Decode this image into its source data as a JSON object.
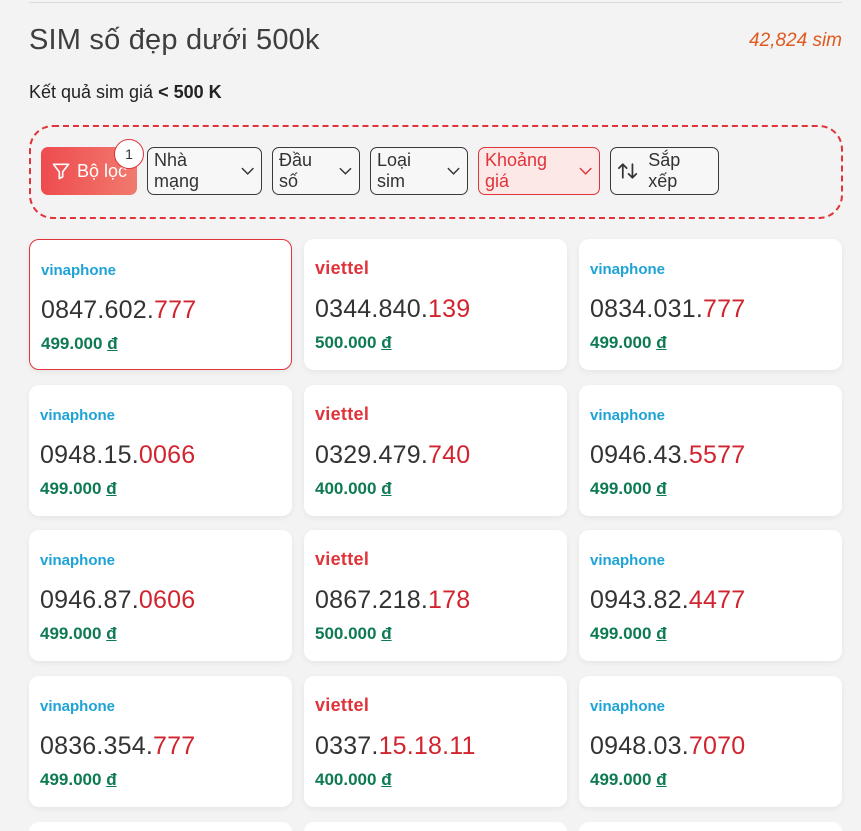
{
  "header": {
    "title": "SIM số đẹp dưới 500k",
    "count": "42,824 sim",
    "subtitle_prefix": "Kết quả sim giá",
    "subtitle_value": "< 500 K"
  },
  "filters": {
    "filter_label": "Bộ lọc",
    "filter_badge": "1",
    "network_label": "Nhà mạng",
    "prefix_label": "Đầu số",
    "type_label": "Loại sim",
    "price_label": "Khoảng giá",
    "sort_label": "Sắp xếp"
  },
  "sims": [
    {
      "carrier": "vinaphone",
      "num_a": "0847.602.",
      "num_b": "777",
      "price": "499.000",
      "currency": "đ"
    },
    {
      "carrier": "viettel",
      "num_a": "0344.840.",
      "num_b": "139",
      "price": "500.000",
      "currency": "đ"
    },
    {
      "carrier": "vinaphone",
      "num_a": "0834.031.",
      "num_b": "777",
      "price": "499.000",
      "currency": "đ"
    },
    {
      "carrier": "vinaphone",
      "num_a": "0948.15.",
      "num_b": "0066",
      "price": "499.000",
      "currency": "đ"
    },
    {
      "carrier": "viettel",
      "num_a": "0329.479.",
      "num_b": "740",
      "price": "400.000",
      "currency": "đ"
    },
    {
      "carrier": "vinaphone",
      "num_a": "0946.43.",
      "num_b": "5577",
      "price": "499.000",
      "currency": "đ"
    },
    {
      "carrier": "vinaphone",
      "num_a": "0946.87.",
      "num_b": "0606",
      "price": "499.000",
      "currency": "đ"
    },
    {
      "carrier": "viettel",
      "num_a": "0867.218.",
      "num_b": "178",
      "price": "500.000",
      "currency": "đ"
    },
    {
      "carrier": "vinaphone",
      "num_a": "0943.82.",
      "num_b": "4477",
      "price": "499.000",
      "currency": "đ"
    },
    {
      "carrier": "vinaphone",
      "num_a": "0836.354.",
      "num_b": "777",
      "price": "499.000",
      "currency": "đ"
    },
    {
      "carrier": "viettel",
      "num_a": "0337.",
      "num_b": "15.18.11",
      "price": "400.000",
      "currency": "đ"
    },
    {
      "carrier": "vinaphone",
      "num_a": "0948.03.",
      "num_b": "7070",
      "price": "499.000",
      "currency": "đ"
    }
  ],
  "colors": {
    "accent": "#e0333a",
    "vinaphone": "#1ea3d6",
    "price": "#0e7a52",
    "count": "#e05a1f"
  },
  "icons": [
    "funnel-icon",
    "chevron-down-icon",
    "sort-arrows-icon"
  ]
}
